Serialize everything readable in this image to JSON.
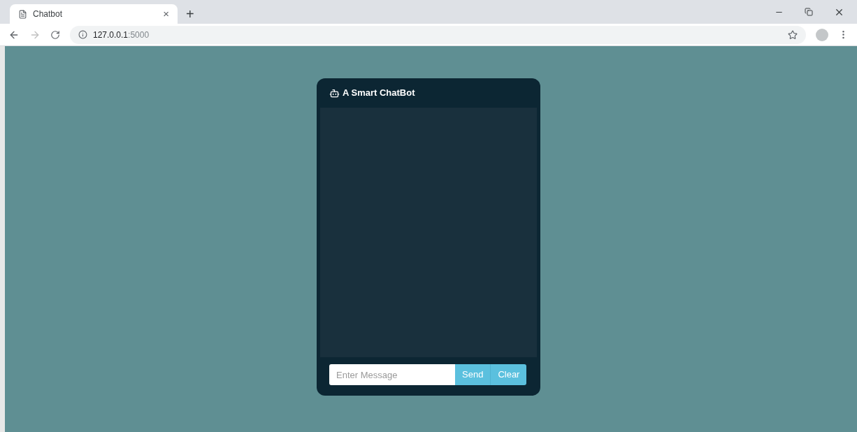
{
  "browser": {
    "tab": {
      "title": "Chatbot",
      "close": "×",
      "selected": true
    },
    "new_tab": "+",
    "url": {
      "host": "127.0.0.1",
      "port": ":5000"
    }
  },
  "chat": {
    "title": "A Smart ChatBot",
    "input": {
      "placeholder": "Enter Message"
    },
    "buttons": [
      "Send",
      "Clear"
    ]
  }
}
